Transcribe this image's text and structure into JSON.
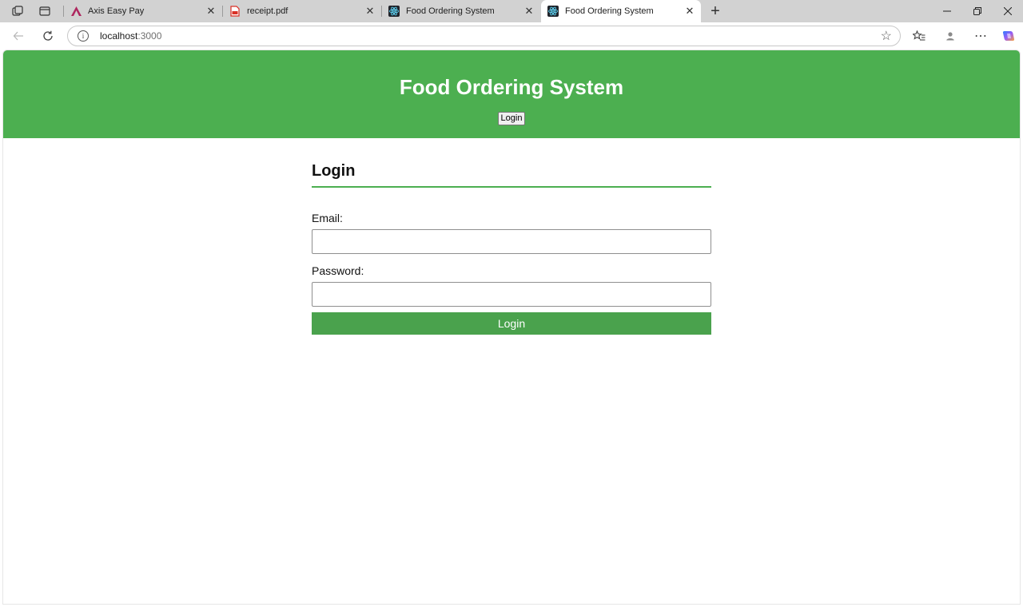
{
  "browser": {
    "tabs": [
      {
        "title": "Axis Easy Pay",
        "icon": "axis-logo-icon",
        "active": false
      },
      {
        "title": "receipt.pdf",
        "icon": "pdf-file-icon",
        "active": false
      },
      {
        "title": "Food Ordering System",
        "icon": "react-logo-icon",
        "active": false
      },
      {
        "title": "Food Ordering System",
        "icon": "react-logo-icon",
        "active": true
      }
    ],
    "address": {
      "host": "localhost",
      "port": ":3000"
    },
    "colors": {
      "tabstrip": "#d2d2d2",
      "axis_brand": "#ae275f",
      "pdf_red": "#d93025",
      "react_blue": "#61dafb"
    }
  },
  "app": {
    "title": "Food Ordering System",
    "nav_login_label": "Login",
    "colors": {
      "primary": "#4caf50",
      "button": "#4aa24d"
    }
  },
  "login_form": {
    "heading": "Login",
    "email_label": "Email:",
    "email_value": "",
    "password_label": "Password:",
    "password_value": "",
    "submit_label": "Login"
  }
}
